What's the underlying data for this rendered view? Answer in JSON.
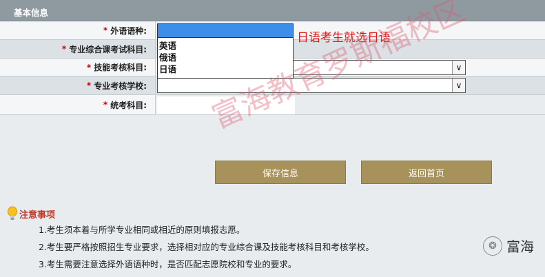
{
  "section": {
    "title": "基本信息"
  },
  "form": {
    "rows": [
      {
        "label": "外语语种:",
        "required": "*"
      },
      {
        "label": "专业综合课考试科目:",
        "required": "*"
      },
      {
        "label": "技能考核科目:",
        "required": "*"
      },
      {
        "label": "专业考核学校:",
        "required": "*"
      },
      {
        "label": "统考科目:",
        "required": "*"
      }
    ],
    "language_options": [
      "英语",
      "俄语",
      "日语"
    ],
    "dropdown_arrow": "∨"
  },
  "annotation": "日语考生就选日语",
  "buttons": {
    "save": "保存信息",
    "back": "返回首页"
  },
  "notes": {
    "title": "注意事项",
    "items": [
      "1.考生须本着与所学专业相同或相近的原则填报志愿。",
      "2.考生要严格按照招生专业要求，选择相对应的专业综合课及技能考核科目和考核学校。",
      "3.考生需要注意选择外语语种时，是否匹配志愿院校和专业的要求。"
    ]
  },
  "watermark": "富海教育罗斯福校区",
  "brand": {
    "text": "富海"
  },
  "colors": {
    "header_bar": "#8e9aa0",
    "button": "#a8925c",
    "annotation": "#e01a1a",
    "selection": "#3d8ee8"
  }
}
